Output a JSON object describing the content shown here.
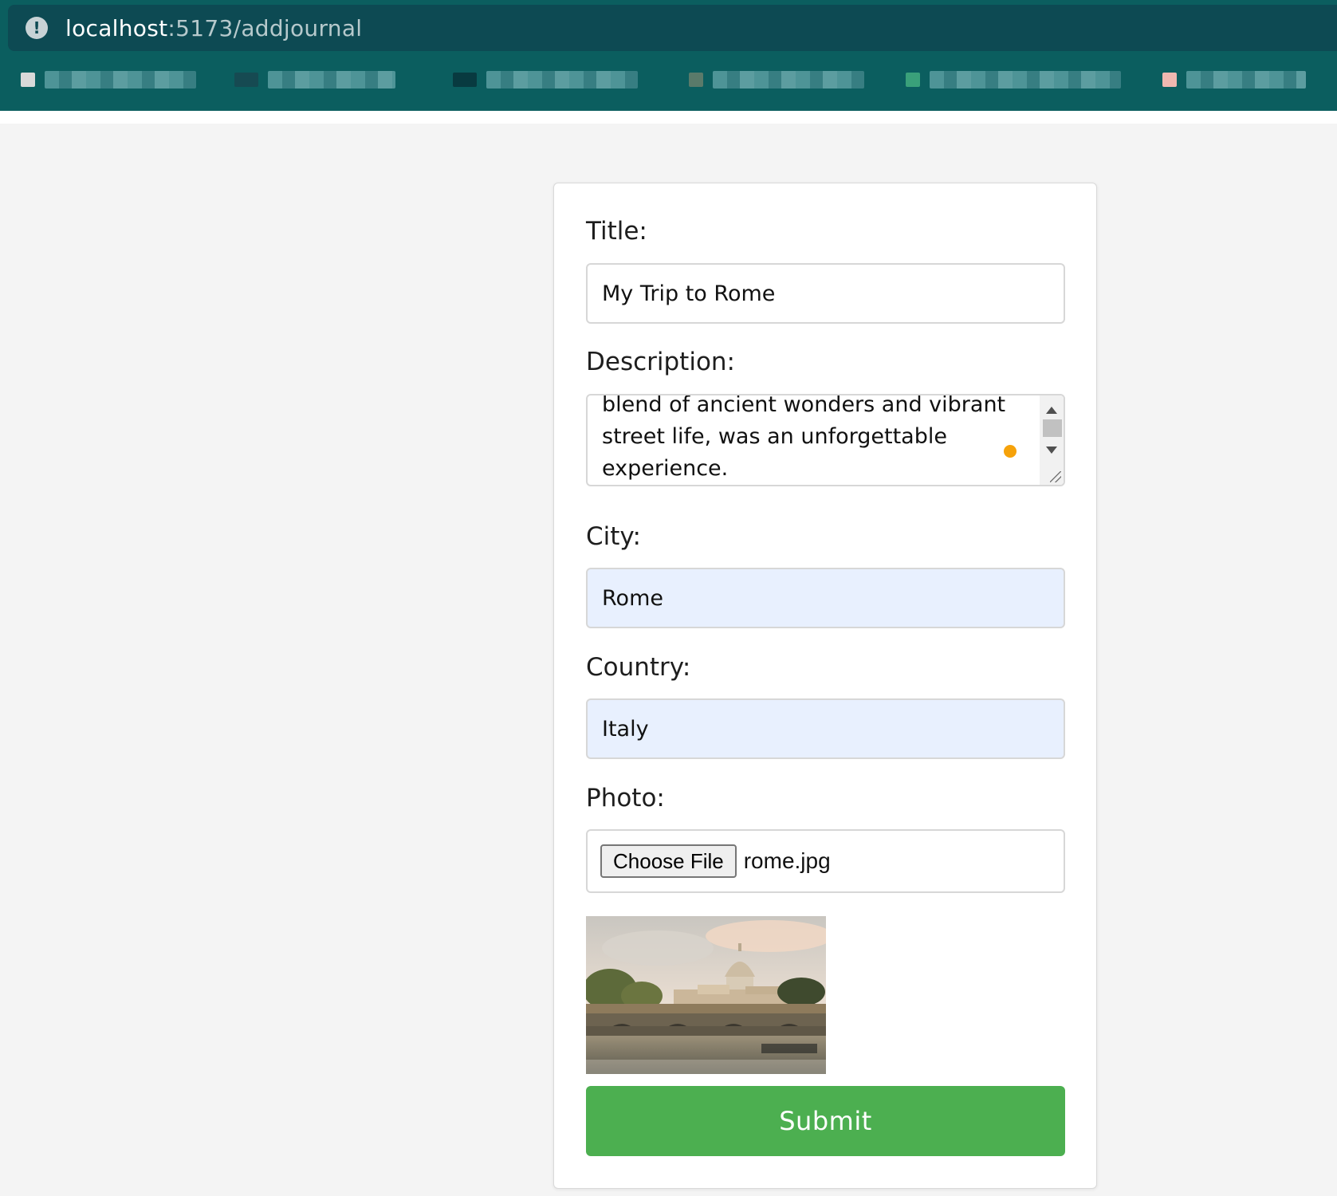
{
  "browser": {
    "url_host": "localhost",
    "url_path": ":5173/addjournal"
  },
  "form": {
    "title_label": "Title:",
    "title_value": "My Trip to Rome",
    "description_label": "Description:",
    "description_lines": [
      "blend of ancient wonders and vibrant",
      "street life, was an unforgettable",
      "experience."
    ],
    "city_label": "City:",
    "city_value": "Rome",
    "country_label": "Country:",
    "country_value": "Italy",
    "photo_label": "Photo:",
    "choose_file_label": "Choose File",
    "file_name": "rome.jpg",
    "preview_icon": "photo-preview-rome",
    "submit_label": "Submit"
  },
  "colors": {
    "chrome": "#0b5e5f",
    "submit": "#4caf50",
    "autofill": "#e8f0fe"
  }
}
